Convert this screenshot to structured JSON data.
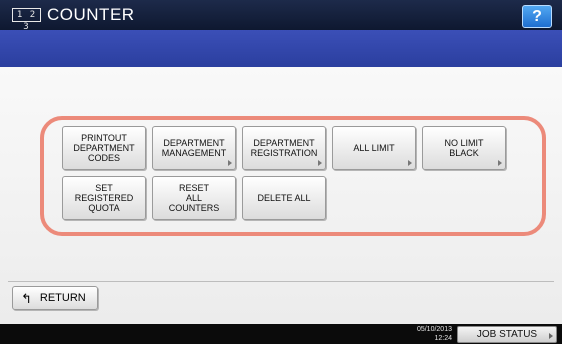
{
  "header": {
    "mode_icon": "1 2 3",
    "title": "COUNTER",
    "help_label": "?"
  },
  "buttons": [
    {
      "label": "PRINTOUT\nDEPARTMENT\nCODES",
      "has_submenu": false
    },
    {
      "label": "DEPARTMENT\nMANAGEMENT",
      "has_submenu": true
    },
    {
      "label": "DEPARTMENT\nREGISTRATION",
      "has_submenu": true
    },
    {
      "label": "ALL LIMIT",
      "has_submenu": true
    },
    {
      "label": "NO LIMIT\nBLACK",
      "has_submenu": true
    },
    {
      "label": "SET\nREGISTERED\nQUOTA",
      "has_submenu": false
    },
    {
      "label": "RESET\nALL\nCOUNTERS",
      "has_submenu": false
    },
    {
      "label": "DELETE ALL",
      "has_submenu": false
    }
  ],
  "footer": {
    "return_label": "RETURN",
    "return_icon": "↰"
  },
  "status": {
    "date": "05/10/2013",
    "time": "12:24",
    "job_status_label": "JOB STATUS"
  },
  "colors": {
    "title_bar": "#16213d",
    "blue_bar": "#3346ab",
    "highlight_frame": "#ec8a7a",
    "help_button": "#2f86e0"
  }
}
